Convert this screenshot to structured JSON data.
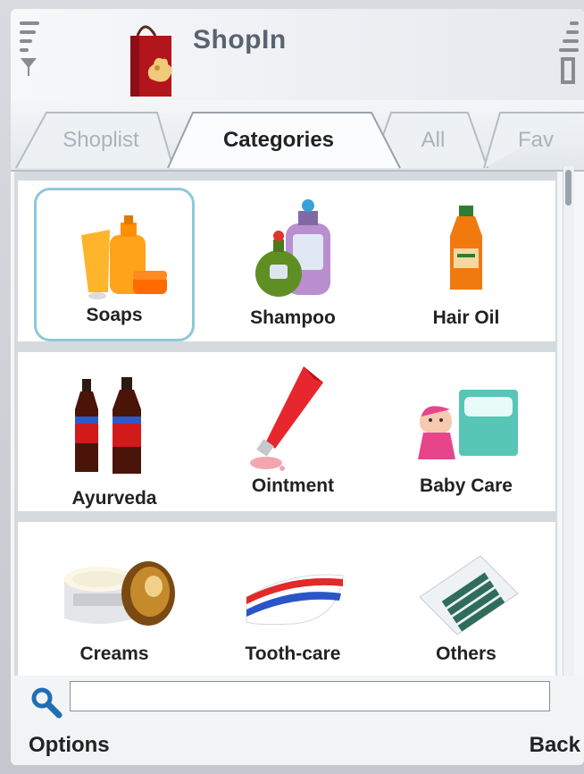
{
  "app": {
    "title": "ShopIn"
  },
  "tabs": [
    {
      "label": "Shoplist"
    },
    {
      "label": "Categories"
    },
    {
      "label": "All"
    },
    {
      "label": "Fav"
    }
  ],
  "active_tab": "Categories",
  "categories": [
    {
      "label": "Soaps",
      "icon": "soap-cream-icon"
    },
    {
      "label": "Shampoo",
      "icon": "shampoo-bottles-icon"
    },
    {
      "label": "Hair Oil",
      "icon": "hair-oil-bottle-icon"
    },
    {
      "label": "Ayurveda",
      "icon": "ayurveda-bottles-icon"
    },
    {
      "label": "Ointment",
      "icon": "ointment-tube-icon"
    },
    {
      "label": "Baby Care",
      "icon": "baby-care-icon"
    },
    {
      "label": "Creams",
      "icon": "cream-jar-icon"
    },
    {
      "label": "Tooth-care",
      "icon": "toothpaste-icon"
    },
    {
      "label": "Others",
      "icon": "batteries-icon"
    }
  ],
  "selected_category": "Soaps",
  "search": {
    "value": "",
    "placeholder": ""
  },
  "softkeys": {
    "left": "Options",
    "right": "Back"
  },
  "colors": {
    "selection": "#8fc8d8",
    "search_icon": "#1f6fb5"
  }
}
